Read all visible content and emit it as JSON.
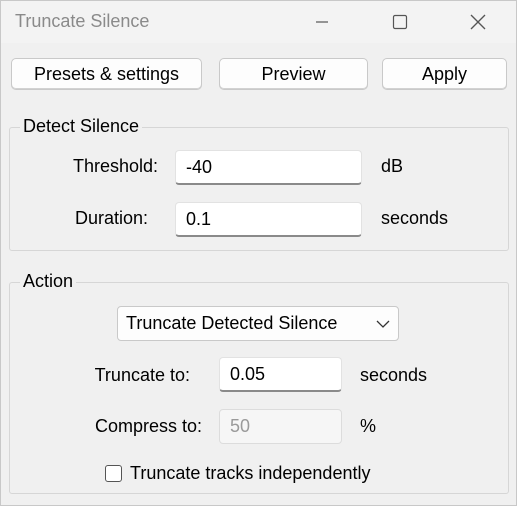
{
  "window": {
    "title": "Truncate Silence",
    "minimize_icon": "minimize-icon",
    "maximize_icon": "maximize-icon",
    "close_icon": "close-icon"
  },
  "toolbar": {
    "presets_label": "Presets & settings",
    "preview_label": "Preview",
    "apply_label": "Apply"
  },
  "detect": {
    "heading": "Detect Silence",
    "threshold_label": "Threshold:",
    "threshold_value": "-40",
    "threshold_unit": "dB",
    "duration_label": "Duration:",
    "duration_value": "0.1",
    "duration_unit": "seconds"
  },
  "action": {
    "heading": "Action",
    "mode_selected": "Truncate Detected Silence",
    "truncate_label": "Truncate to:",
    "truncate_value": "0.05",
    "truncate_unit": "seconds",
    "compress_label": "Compress to:",
    "compress_value": "50",
    "compress_unit": "%",
    "independent_label": "Truncate tracks independently",
    "independent_checked": false
  }
}
